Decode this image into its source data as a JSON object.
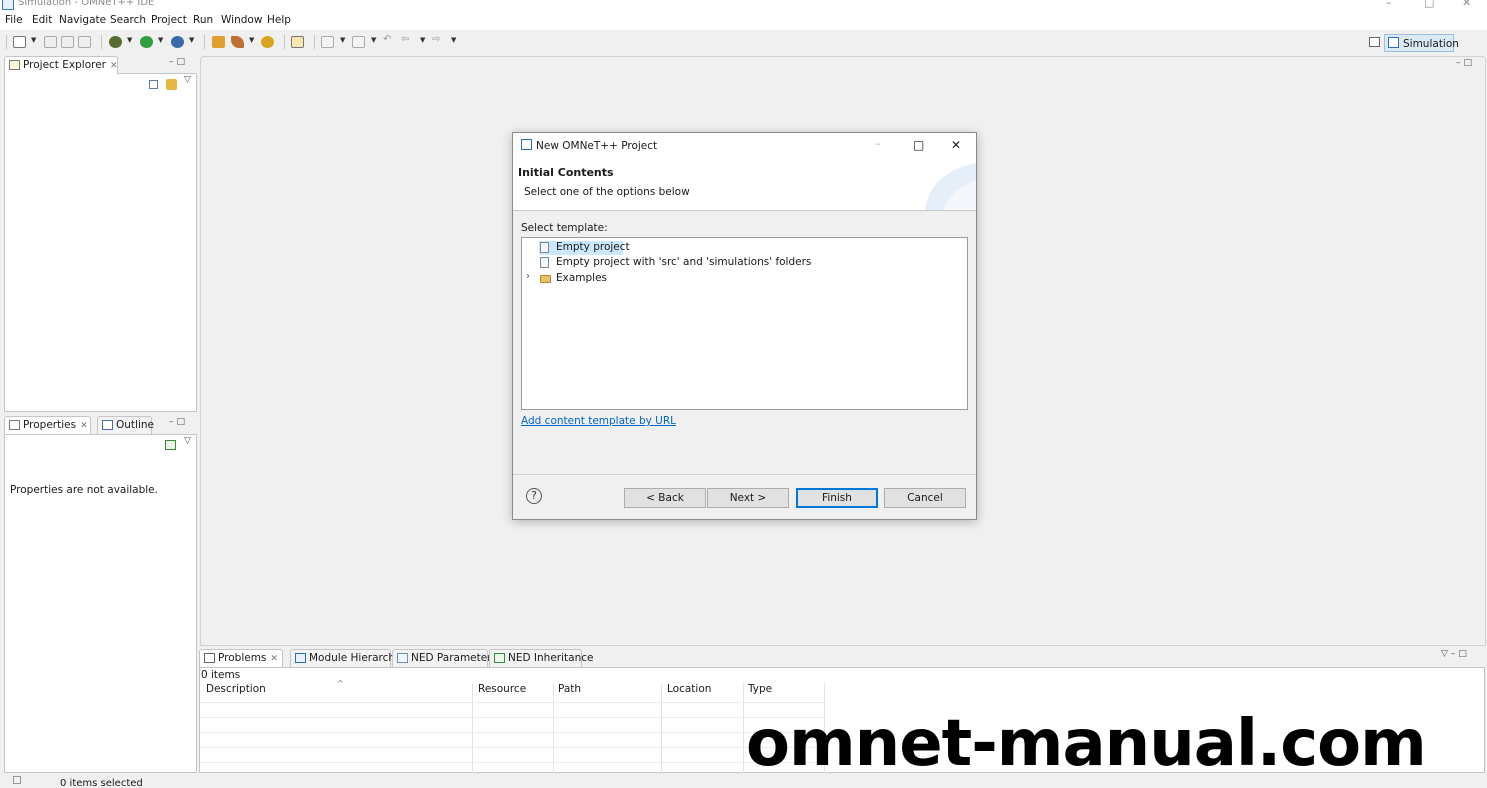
{
  "window": {
    "title": "Simulation - OMNeT++ IDE",
    "controls": [
      "–",
      "□",
      "✕"
    ]
  },
  "menu": [
    "File",
    "Edit",
    "Navigate",
    "Search",
    "Project",
    "Run",
    "Window",
    "Help"
  ],
  "perspective": {
    "label": "Simulation"
  },
  "project_explorer": {
    "tab": "Project Explorer"
  },
  "properties": {
    "tab": "Properties",
    "outline_tab": "Outline",
    "message": "Properties are not available."
  },
  "dialog": {
    "title": "New OMNeT++ Project",
    "heading": "Initial Contents",
    "subheading": "Select one of the options below",
    "select_label": "Select template:",
    "templates": [
      "Empty project",
      "Empty project with 'src' and 'simulations' folders",
      "Examples"
    ],
    "link": "Add content template by URL",
    "buttons": {
      "back": "< Back",
      "next": "Next >",
      "finish": "Finish",
      "cancel": "Cancel"
    },
    "help": "?"
  },
  "bottom": {
    "tabs": [
      "Problems",
      "Module Hierarchy",
      "NED Parameters",
      "NED Inheritance"
    ],
    "count": "0 items",
    "columns": [
      "Description",
      "Resource",
      "Path",
      "Location",
      "Type"
    ]
  },
  "status": {
    "text": "0 items selected"
  },
  "watermark": "omnet-manual.com",
  "colors": {
    "accent": "#0078d7",
    "link": "#0066cc",
    "selection": "#cce8ff"
  }
}
